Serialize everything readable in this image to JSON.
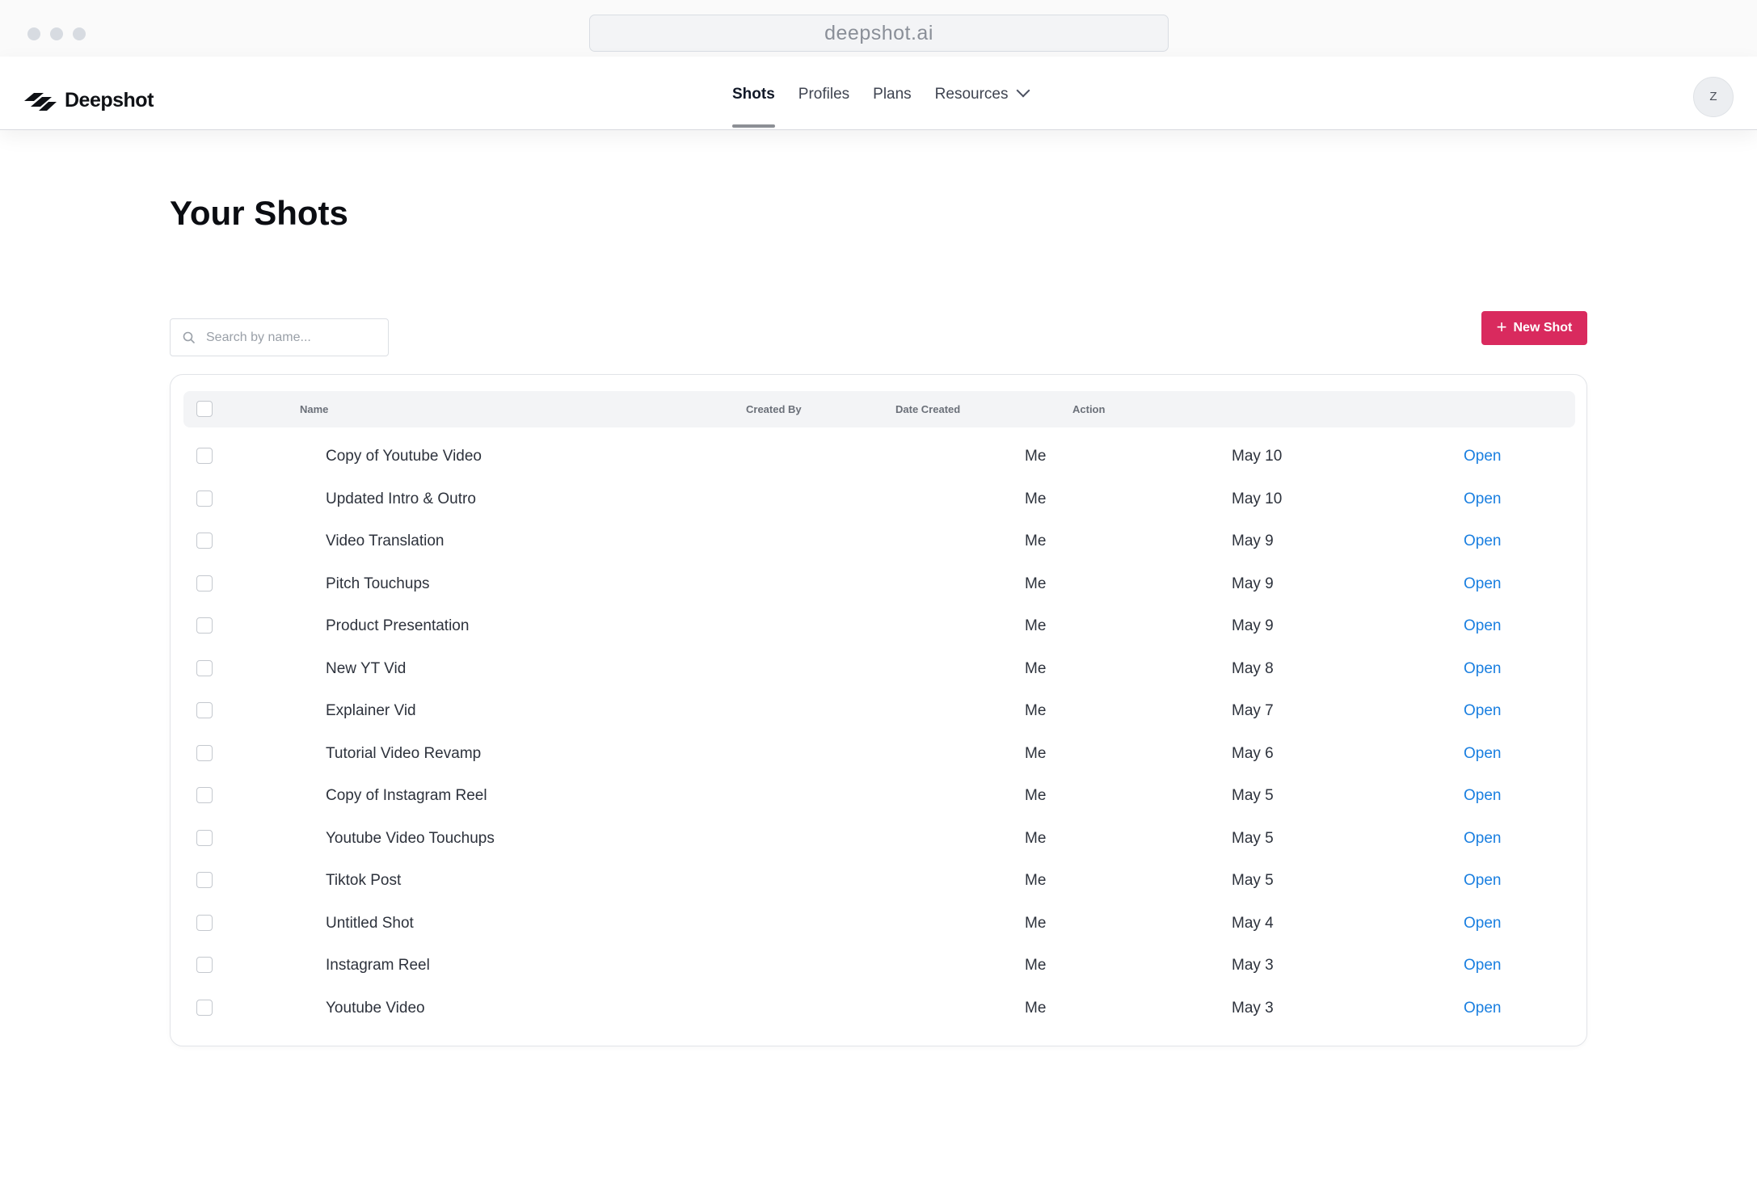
{
  "browser": {
    "url": "deepshot.ai"
  },
  "brand": {
    "name": "Deepshot",
    "accent_color": "#d92a5e",
    "link_color": "#1a7fe0"
  },
  "nav": {
    "items": [
      {
        "label": "Shots",
        "active": true
      },
      {
        "label": "Profiles",
        "active": false
      },
      {
        "label": "Plans",
        "active": false
      },
      {
        "label": "Resources",
        "active": false,
        "has_dropdown": true
      }
    ]
  },
  "user": {
    "avatar_initial": "Z"
  },
  "page": {
    "title": "Your Shots"
  },
  "search": {
    "placeholder": "Search by name...",
    "value": ""
  },
  "new_button": {
    "label": "New Shot",
    "icon": "plus-icon"
  },
  "table": {
    "columns": {
      "name": "Name",
      "created_by": "Created By",
      "date_created": "Date Created",
      "action": "Action"
    },
    "rows": [
      {
        "name": "Copy of Youtube Video",
        "created_by": "Me",
        "date": "May 10",
        "action": "Open"
      },
      {
        "name": "Updated Intro & Outro",
        "created_by": "Me",
        "date": "May 10",
        "action": "Open"
      },
      {
        "name": "Video Translation",
        "created_by": "Me",
        "date": "May 9",
        "action": "Open"
      },
      {
        "name": "Pitch Touchups",
        "created_by": "Me",
        "date": "May 9",
        "action": "Open"
      },
      {
        "name": "Product Presentation",
        "created_by": "Me",
        "date": "May 9",
        "action": "Open"
      },
      {
        "name": "New YT Vid",
        "created_by": "Me",
        "date": "May 8",
        "action": "Open"
      },
      {
        "name": "Explainer Vid",
        "created_by": "Me",
        "date": "May 7",
        "action": "Open"
      },
      {
        "name": "Tutorial Video Revamp",
        "created_by": "Me",
        "date": "May 6",
        "action": "Open"
      },
      {
        "name": "Copy of Instagram Reel",
        "created_by": "Me",
        "date": "May 5",
        "action": "Open"
      },
      {
        "name": "Youtube Video Touchups",
        "created_by": "Me",
        "date": "May 5",
        "action": "Open"
      },
      {
        "name": "Tiktok Post",
        "created_by": "Me",
        "date": "May 5",
        "action": "Open"
      },
      {
        "name": "Untitled Shot",
        "created_by": "Me",
        "date": "May 4",
        "action": "Open"
      },
      {
        "name": "Instagram Reel",
        "created_by": "Me",
        "date": "May 3",
        "action": "Open"
      },
      {
        "name": "Youtube Video",
        "created_by": "Me",
        "date": "May 3",
        "action": "Open"
      }
    ]
  }
}
